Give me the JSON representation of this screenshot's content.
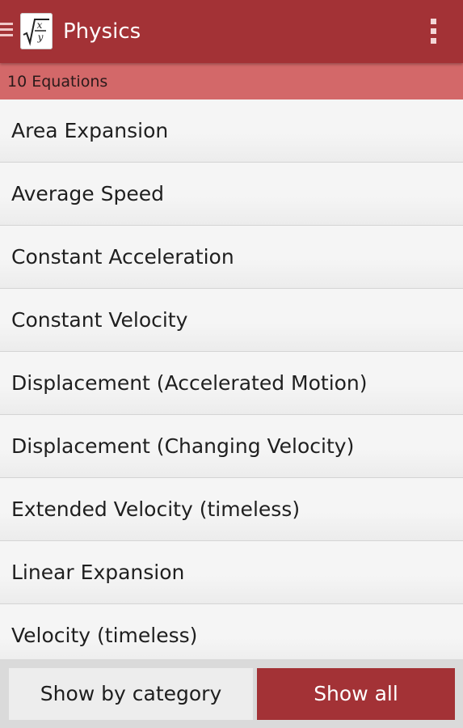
{
  "app_bar": {
    "title": "Physics",
    "nav_icon": "menu-drawer-icon",
    "app_icon": "sqrt-fraction-icon",
    "overflow_icon": "more-vert-icon",
    "color": "#a33236"
  },
  "subheader": {
    "count_label": "10 Equations",
    "color": "#d36869"
  },
  "equations": [
    "Area Expansion",
    "Average Speed",
    "Constant Acceleration",
    "Constant Velocity",
    "Displacement (Accelerated Motion)",
    "Displacement (Changing Velocity)",
    "Extended Velocity (timeless)",
    "Linear Expansion",
    "Velocity (timeless)"
  ],
  "filter": {
    "by_category_label": "Show by category",
    "show_all_label": "Show all",
    "selected": "Show all"
  }
}
